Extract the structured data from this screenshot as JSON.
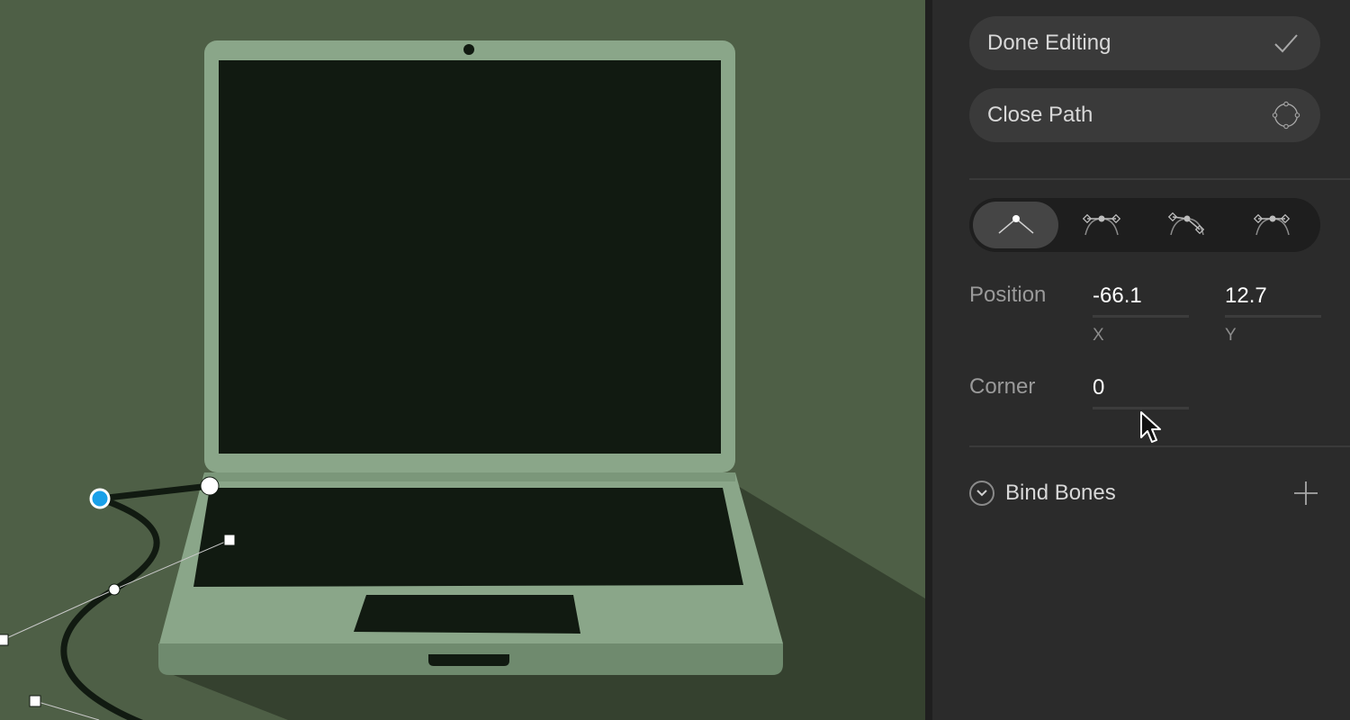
{
  "panel": {
    "done_editing_label": "Done Editing",
    "close_path_label": "Close Path",
    "vertex_types": [
      {
        "icon": "straight-vertex-icon",
        "active": true
      },
      {
        "icon": "mirrored-vertex-icon",
        "active": false
      },
      {
        "icon": "detached-vertex-icon",
        "active": false
      },
      {
        "icon": "asymmetric-vertex-icon",
        "active": false
      }
    ],
    "position_label": "Position",
    "position_x": "-66.1",
    "position_y": "12.7",
    "x_label": "X",
    "y_label": "Y",
    "corner_label": "Corner",
    "corner_value": "0",
    "bind_bones_label": "Bind Bones"
  },
  "colors": {
    "canvas_bg": "#4e5f46",
    "canvas_shadow": "#35412f",
    "laptop_body": "#8aa689",
    "laptop_dark": "#6f8a6e",
    "screen": "#111a11",
    "selected_vertex": "#19a0e8",
    "panel_bg": "#2b2b2b",
    "button_bg": "#3a3a3a"
  }
}
